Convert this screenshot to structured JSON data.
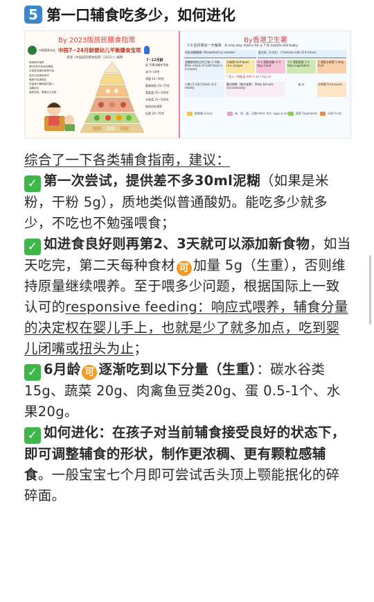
{
  "header": {
    "number": "5",
    "title": "第一口辅食吃多少，如何进化"
  },
  "banner": {
    "left": {
      "source": "By 2023版居民膳食指南",
      "org": "中国营养学会",
      "title": "中国7~24月龄婴幼儿平衡膳食宝塔",
      "subtitle": "来源《中国居民膳食指南（2022）》编制",
      "age_band": "7~12月龄",
      "notes": [
        "继续母乳喂养",
        "满6月龄开始添加辅食",
        "从富铁泥糊状食物开始",
        "逐步达到食物多样",
        "辅食不加调味品",
        "尽量减少糖和盐的摄入",
        "油脂适当",
        "鼓励进食、尊重自主进食",
        "定期测量体重和身长",
        "监测生长发育"
      ],
      "rows": [
        "盐 不建议额外添加",
        "油 0~10克",
        "鸡蛋 15~50克",
        "畜禽肉鱼 25~75克",
        "蔬菜类 25~100克",
        "水果类 25~100克",
        "继续母乳喂养",
        "谷类 20~75克"
      ]
    },
    "right": {
      "source": "By香港卫生署",
      "chinese_menu": "7-8 個月嬰兒一天餐單",
      "english_menu": "A one-day menu for a 7-8 month-old baby",
      "head_left": "母乳按需餵哺 / Breastfeed as needed",
      "head_right": "配方奶（3-4次） / Formula milk (3-4 times)",
      "main_meals": "固體食物為主的正餐 (1-2餐) Main meals of solid food (1-2 meals)",
      "cells": [
        "半碗粥 Half bowl rice congee",
        "½-1 湯匙肉類 ½-1 tbsp meat",
        "1-2 湯匙蔬菜 1-2 tbsp vegetables",
        "1 湯匙水果蓉 1 tbsp fruit"
      ],
      "note": "* 加入一茶匙油 Add ½ to 1 tsp oil",
      "snack": "小食 (1-2次) Snack (1-2 meals)",
      "snack_cells": [
        "嬰兒餅乾（間中進食） Baby biscuits (occasionally)",
        "或 or",
        "水果蓉 Fruit puree"
      ],
      "legend": [
        {
          "label": "穀物類 Grains",
          "color": "#f2c744"
        },
        {
          "label": "肉、魚、蛋、豆類 Meat, fish, eggs & beans",
          "color": "#e8a0c8"
        },
        {
          "label": "蔬菜 Vegetables",
          "color": "#8fce5a"
        },
        {
          "label": "水果 Fruits",
          "color": "#f08a3a"
        }
      ]
    }
  },
  "body": {
    "intro": "综合了一下各类辅食指南，建议：",
    "check": "✓",
    "ke": "可",
    "p1_bold": "第一次尝试，提供差不多30ml泥糊",
    "p1_rest": "（如果是米粉，干粉 5g），质地类似普通酸奶。能吃多少就多少，不吃也不勉强喂食；",
    "p2_bold": "如进食良好则再第2、3天就可以添加新食物",
    "p2_a": "，如当天吃完，第二天每种食材",
    "p2_b": "加量 5g（生重），否则维持原量继续喂养。至于喂多少问题，根据国际上一致认可的",
    "p2_ul": "responsive feeding：响应式喂养，辅食分量的决定权在婴儿手上，也就是少了就多加点，吃到婴儿闭嘴或扭头为止",
    "p2_end": "；",
    "p3_bold_a": "6月龄",
    "p3_bold_b": "逐渐吃到以下分量（生重）",
    "p3_rest": "：碳水谷类15g、蔬菜 20g、肉禽鱼豆类20g、蛋 0.5-1个、水果20g。",
    "p4_bold": "如何进化：在孩子对当前辅食接受良好的状态下，即可调整辅食的形状，制作更浓稠、更有颗粒感辅食",
    "p4_rest": "。一般宝宝七个月即可尝试舌头顶上颚能抿化的碎碎面。"
  }
}
